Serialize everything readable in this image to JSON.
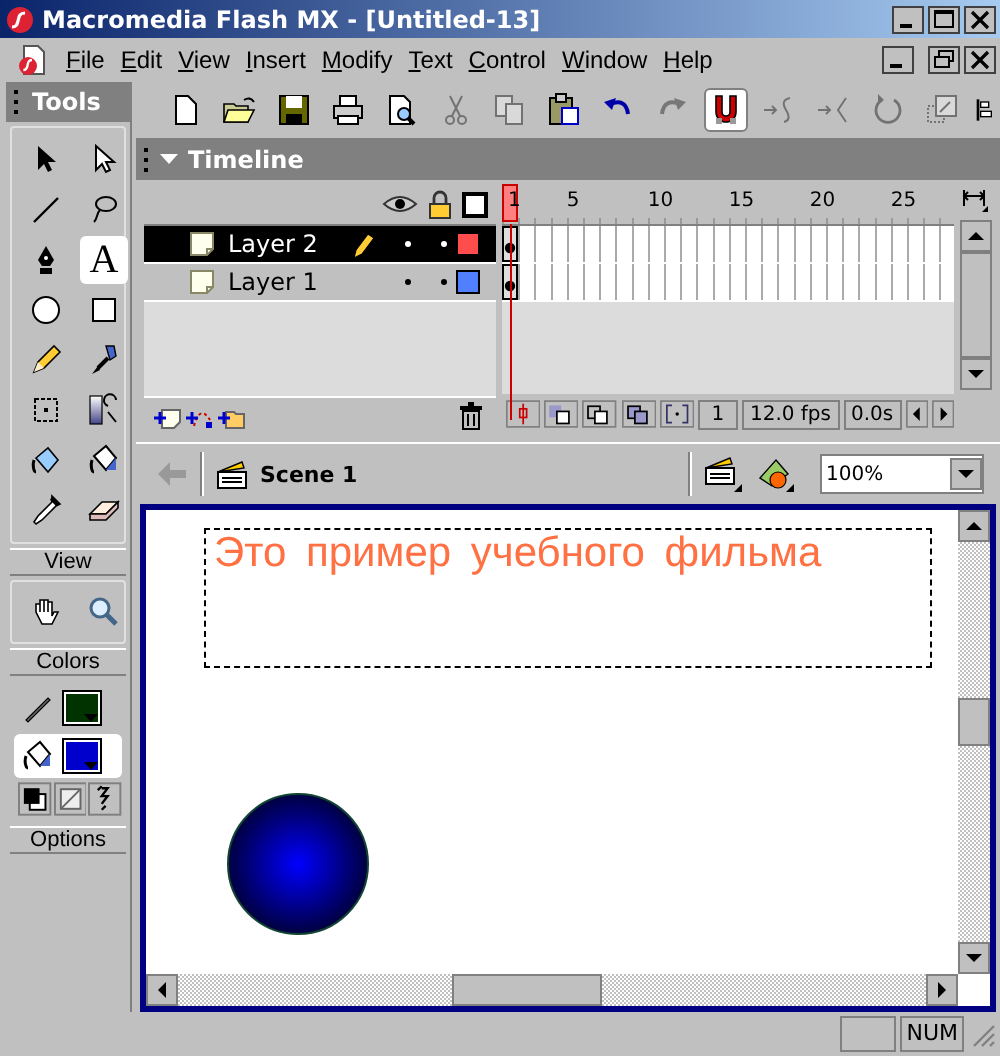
{
  "window": {
    "title": "Macromedia Flash MX - [Untitled-13]"
  },
  "menu": [
    "File",
    "Edit",
    "View",
    "Insert",
    "Modify",
    "Text",
    "Control",
    "Window",
    "Help"
  ],
  "toolbar": [
    {
      "kind": "new",
      "disabled": false,
      "on": false
    },
    {
      "kind": "open",
      "disabled": false,
      "on": false
    },
    {
      "kind": "save",
      "disabled": false,
      "on": false
    },
    {
      "kind": "print",
      "disabled": false,
      "on": false
    },
    {
      "kind": "preview",
      "disabled": false,
      "on": false
    },
    {
      "kind": "cut",
      "disabled": true,
      "on": false
    },
    {
      "kind": "copy",
      "disabled": true,
      "on": false
    },
    {
      "kind": "paste",
      "disabled": false,
      "on": false
    },
    {
      "kind": "undo",
      "disabled": false,
      "on": false
    },
    {
      "kind": "redo",
      "disabled": true,
      "on": false
    },
    {
      "kind": "snap",
      "disabled": false,
      "on": true
    },
    {
      "kind": "smooth",
      "disabled": true,
      "on": false
    },
    {
      "kind": "straighten",
      "disabled": true,
      "on": false
    },
    {
      "kind": "rotate",
      "disabled": true,
      "on": false
    },
    {
      "kind": "scale",
      "disabled": true,
      "on": false
    },
    {
      "kind": "align",
      "disabled": false,
      "on": false
    }
  ],
  "tools_panel": {
    "title": "Tools",
    "tools": [
      {
        "kind": "arrow",
        "selected": false
      },
      {
        "kind": "subselect",
        "selected": false
      },
      {
        "kind": "line",
        "selected": false
      },
      {
        "kind": "lasso",
        "selected": false
      },
      {
        "kind": "pen",
        "selected": false
      },
      {
        "kind": "text",
        "label": "A",
        "selected": true
      },
      {
        "kind": "oval",
        "selected": false
      },
      {
        "kind": "rect",
        "selected": false
      },
      {
        "kind": "pencil",
        "selected": false
      },
      {
        "kind": "brush",
        "selected": false
      },
      {
        "kind": "free-transform",
        "selected": false
      },
      {
        "kind": "fill-transform",
        "selected": false
      },
      {
        "kind": "ink-bottle",
        "selected": false
      },
      {
        "kind": "paint-bucket",
        "selected": false
      },
      {
        "kind": "eyedropper",
        "selected": false
      },
      {
        "kind": "eraser",
        "selected": false
      }
    ],
    "view_title": "View",
    "view_tools": [
      {
        "kind": "hand",
        "selected": false
      },
      {
        "kind": "zoom",
        "selected": false
      }
    ],
    "colors_title": "Colors",
    "colors": [
      {
        "kind": "stroke",
        "color": "#003300",
        "selected": false
      },
      {
        "kind": "fill",
        "color": "#0000cc",
        "selected": true
      }
    ],
    "options_title": "Options"
  },
  "timeline": {
    "title": "Timeline",
    "layers": [
      {
        "name": "Layer 2",
        "selected": true,
        "editing": true,
        "color": "#ff4c4c"
      },
      {
        "name": "Layer 1",
        "selected": false,
        "editing": false,
        "color": "#5080ff"
      }
    ],
    "ruler": [
      "1",
      "5",
      "10",
      "15",
      "20",
      "25"
    ],
    "current_frame": "1",
    "frame_rate": "12.0 fps",
    "elapsed": "0.0s"
  },
  "scene_bar": {
    "scene": "Scene 1",
    "zoom": "100%"
  },
  "stage": {
    "text": "Это пример учебного фильма"
  },
  "status_bar": {
    "indicators": [
      "NUM"
    ]
  }
}
